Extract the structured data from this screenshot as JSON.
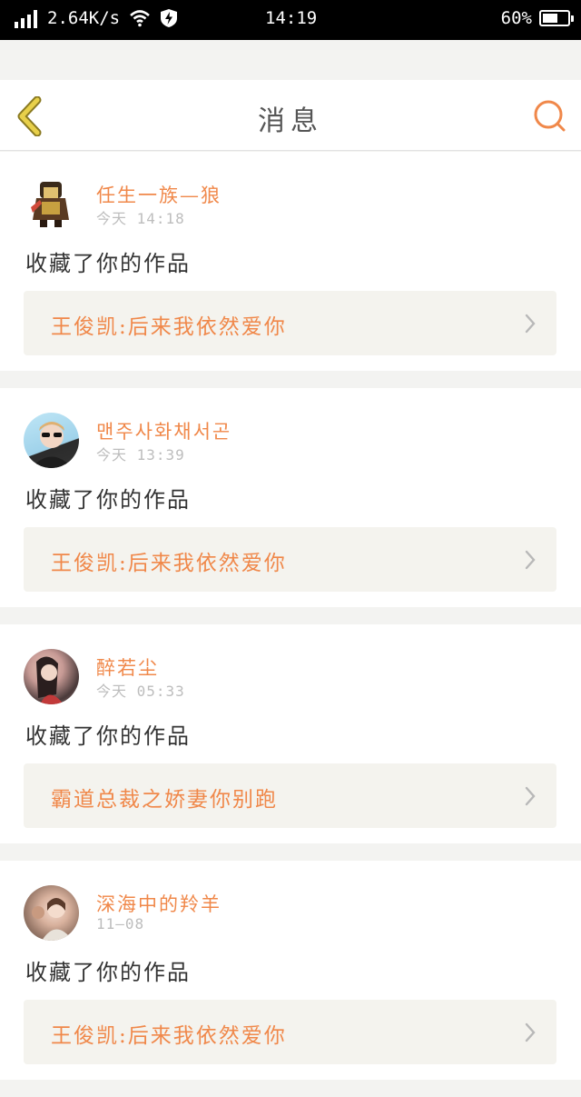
{
  "status_bar": {
    "speed": "2.64K/s",
    "time": "14:19",
    "battery": "60%",
    "battery_level": 0.6
  },
  "header": {
    "title": "消息"
  },
  "colors": {
    "accent": "#f0884a",
    "back_icon": "#e8d04a",
    "card_link_bg": "#f4f3ee"
  },
  "notifications": [
    {
      "username": "任生一族—狼",
      "time": "今天 14:18",
      "action": "收藏了你的作品",
      "work_title": "王俊凯:后来我依然爱你"
    },
    {
      "username": "맨주사화채서곤",
      "time": "今天 13:39",
      "action": "收藏了你的作品",
      "work_title": "王俊凯:后来我依然爱你"
    },
    {
      "username": "醉若尘",
      "time": "今天 05:33",
      "action": "收藏了你的作品",
      "work_title": "霸道总裁之娇妻你别跑"
    },
    {
      "username": "深海中的羚羊",
      "time": "11—08",
      "action": "收藏了你的作品",
      "work_title": "王俊凯:后来我依然爱你"
    }
  ]
}
